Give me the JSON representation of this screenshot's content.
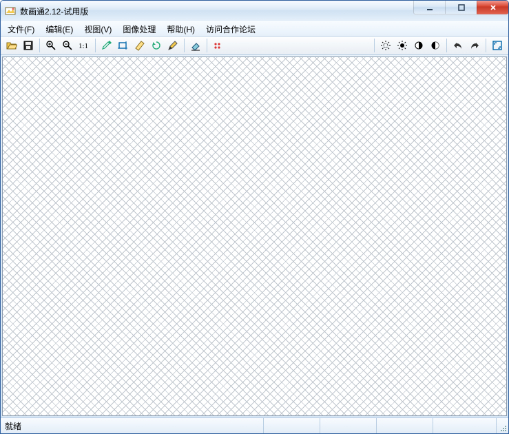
{
  "title": "数画通2.12-试用版",
  "menu": {
    "file": "文件(F)",
    "edit": "编辑(E)",
    "view": "视图(V)",
    "image": "图像处理",
    "help": "帮助(H)",
    "forum": "访问合作论坛"
  },
  "toolbar_icons": {
    "open": "open-icon",
    "save": "save-icon",
    "zoom_in": "zoom-in-icon",
    "zoom_out": "zoom-out-icon",
    "actual_size": "actual-size-icon",
    "eyedropper": "eyedropper-icon",
    "crop": "crop-icon",
    "deskew": "deskew-icon",
    "rotate": "rotate-icon",
    "pencil": "pencil-icon",
    "eraser": "eraser-icon",
    "grid": "grid-icon",
    "brightness_up": "brightness-up-icon",
    "brightness_down": "brightness-down-icon",
    "contrast_up": "contrast-up-icon",
    "contrast_down": "contrast-down-icon",
    "undo": "undo-icon",
    "redo": "redo-icon",
    "fullscreen": "fullscreen-icon"
  },
  "status": {
    "ready": "就绪"
  },
  "colors": {
    "accent": "#2f5f9e",
    "close": "#c83a28"
  }
}
